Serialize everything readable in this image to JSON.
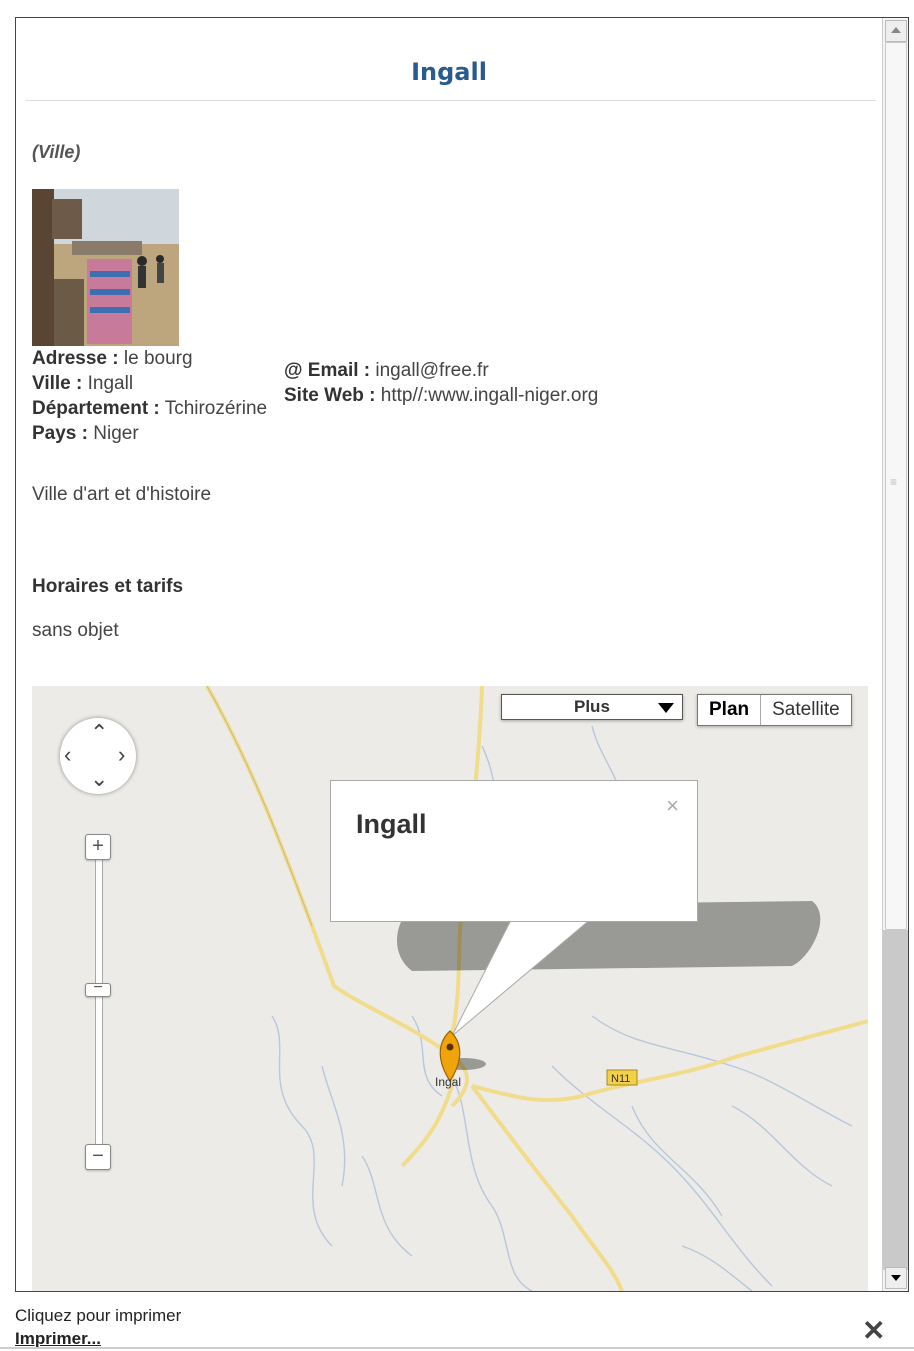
{
  "page": {
    "title": "Ingall",
    "category": "(Ville)"
  },
  "photo": {
    "icon": "market-photo"
  },
  "info": {
    "address_label": "Adresse :",
    "address_value": "le bourg",
    "city_label": "Ville :",
    "city_value": "Ingall",
    "dept_label": "Département :",
    "dept_value": "Tchirozérine",
    "country_label": "Pays :",
    "country_value": "Niger",
    "email_label": "@ Email :",
    "email_value": "ingall@free.fr",
    "web_label": "Site Web :",
    "web_value": "http//:www.ingall-niger.org"
  },
  "description": "Ville d'art et d'histoire",
  "hours": {
    "heading": "Horaires et tarifs",
    "value": "sans objet"
  },
  "map": {
    "more_label": "Plus",
    "type_plan": "Plan",
    "type_satellite": "Satellite",
    "bubble_title": "Ingall",
    "bubble_close": "×",
    "marker_label": "Ingal",
    "road_label": "N11",
    "zoom_in": "+",
    "zoom_out": "−"
  },
  "footer": {
    "hint": "Cliquez pour imprimer",
    "print_link": "Imprimer...",
    "close": "✕"
  },
  "colors": {
    "title": "#2a5b8f",
    "map_bg": "#ecebe7",
    "road": "#f1dc8b",
    "river": "#b7c7dd",
    "marker": "#f0a30a"
  }
}
